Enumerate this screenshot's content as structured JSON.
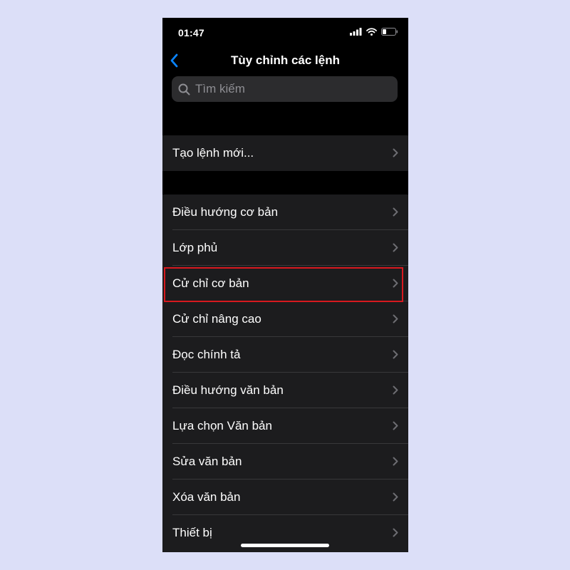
{
  "status_bar": {
    "time": "01:47"
  },
  "nav": {
    "title": "Tùy chỉnh các lệnh"
  },
  "search": {
    "placeholder": "Tìm kiếm"
  },
  "group1": {
    "items": [
      {
        "label": "Tạo lệnh mới..."
      }
    ]
  },
  "group2": {
    "items": [
      {
        "label": "Điều hướng cơ bản"
      },
      {
        "label": "Lớp phủ"
      },
      {
        "label": "Cử chỉ cơ bản"
      },
      {
        "label": "Cử chỉ nâng cao"
      },
      {
        "label": "Đọc chính tả"
      },
      {
        "label": "Điều hướng văn bản"
      },
      {
        "label": "Lựa chọn Văn bản"
      },
      {
        "label": "Sửa văn bản"
      },
      {
        "label": "Xóa văn bản"
      },
      {
        "label": "Thiết bị"
      }
    ]
  },
  "colors": {
    "accent": "#0a84ff",
    "highlight": "#d7191f",
    "cell_background": "#1c1c1e",
    "page_background": "#dcdff8"
  }
}
